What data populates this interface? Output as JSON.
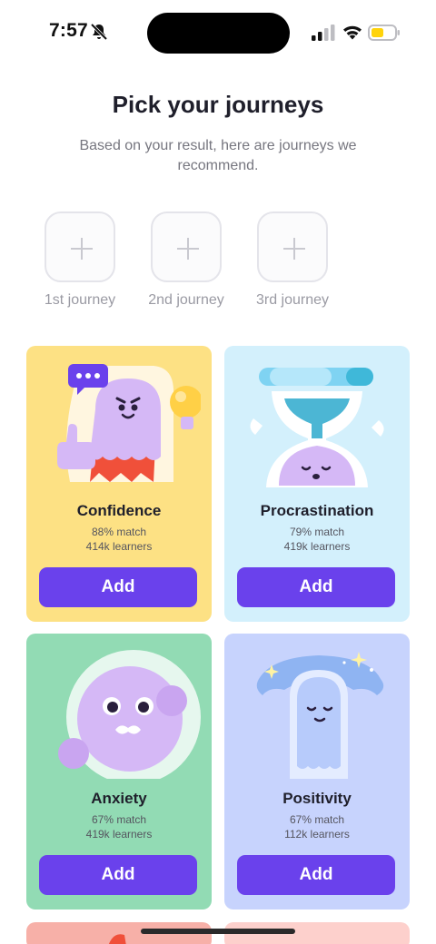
{
  "status": {
    "time": "7:57",
    "battery_color": "#ffd30a"
  },
  "header": {
    "title": "Pick your journeys",
    "subtitle": "Based on your result, here are journeys we recommend."
  },
  "slots": [
    {
      "label": "1st journey"
    },
    {
      "label": "2nd journey"
    },
    {
      "label": "3rd journey"
    }
  ],
  "cards": [
    {
      "title": "Confidence",
      "match": "88% match",
      "learners": "414k learners",
      "button": "Add",
      "bg": "#fde184",
      "icon": "confident-ghost-icon"
    },
    {
      "title": "Procrastination",
      "match": "79% match",
      "learners": "419k learners",
      "button": "Add",
      "bg": "#d3f0fc",
      "icon": "hourglass-icon"
    },
    {
      "title": "Anxiety",
      "match": "67% match",
      "learners": "419k learners",
      "button": "Add",
      "bg": "#92dbb4",
      "icon": "anxious-blob-icon"
    },
    {
      "title": "Positivity",
      "match": "67% match",
      "learners": "112k learners",
      "button": "Add",
      "bg": "#c7d3fd",
      "icon": "calm-ghost-icon"
    }
  ],
  "accent": "#6a41ec"
}
